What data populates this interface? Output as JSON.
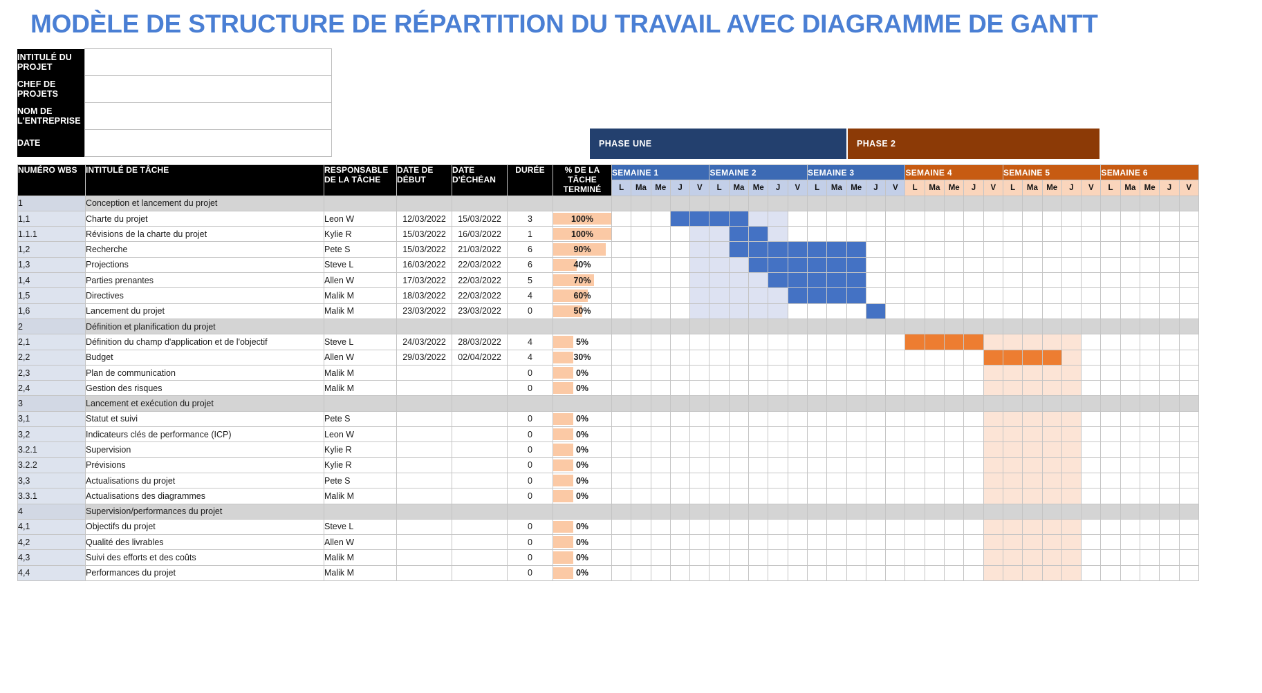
{
  "page_title": "MODÈLE DE STRUCTURE DE RÉPARTITION DU TRAVAIL AVEC DIAGRAMME DE GANTT",
  "info_block": [
    {
      "label": "INTITULÉ DU PROJET",
      "value": ""
    },
    {
      "label": "CHEF DE PROJETS",
      "value": ""
    },
    {
      "label": "NOM DE L'ENTREPRISE",
      "value": ""
    },
    {
      "label": "DATE",
      "value": ""
    }
  ],
  "phases": [
    {
      "label": "PHASE UNE",
      "color": "#23406e",
      "weeks": 3
    },
    {
      "label": "PHASE 2",
      "color": "#8c3a06",
      "weeks": 3
    }
  ],
  "columns": {
    "wbs": "NUMÉRO WBS",
    "task": "INTITULÉ DE TÂCHE",
    "resp": "RESPONSABLE DE LA TÂCHE",
    "start": "DATE DE DÉBUT",
    "end": "DATE D'ÉCHÉAN",
    "duration": "DURÉE",
    "percent": "% DE LA TÂCHE TERMINÉ"
  },
  "weeks": [
    {
      "label": "SEMAINE 1",
      "theme": "blue"
    },
    {
      "label": "SEMAINE 2",
      "theme": "blue"
    },
    {
      "label": "SEMAINE 3",
      "theme": "blue"
    },
    {
      "label": "SEMAINE 4",
      "theme": "orange"
    },
    {
      "label": "SEMAINE 5",
      "theme": "orange"
    },
    {
      "label": "SEMAINE 6",
      "theme": "orange"
    }
  ],
  "days": [
    "L",
    "Ma",
    "Me",
    "J",
    "V"
  ],
  "colors": {
    "title": "#4a7fd4",
    "phase_one": "#23406e",
    "phase_two": "#8c3a06",
    "week_blue": "#3c6ab4",
    "week_orange": "#c75b12",
    "day_blue": "#c3cfe8",
    "day_orange": "#fad5bc",
    "bar_blue": "#4472c4",
    "bar_orange": "#ed7d31",
    "shade_blue": "#dde2f2",
    "shade_orange": "#fce4d6",
    "pct_bar": "#fbc9a5",
    "wbs_bg": "#dde3ee",
    "section_bg": "#d4d4d4"
  },
  "rows": [
    {
      "type": "section",
      "wbs": "1",
      "task": "Conception et lancement du projet",
      "resp": "",
      "start": "",
      "end": "",
      "duration": "",
      "percent": "",
      "pct_value": 0,
      "bar": null,
      "shade": null
    },
    {
      "type": "task",
      "wbs": "1,1",
      "task": "Charte du projet",
      "resp": "Leon W",
      "start": "12/03/2022",
      "end": "15/03/2022",
      "duration": "3",
      "percent": "100%",
      "pct_value": 100,
      "bar": {
        "start": 4,
        "len": 4,
        "color": "blue"
      },
      "shade": {
        "start": 5,
        "len": 5,
        "color": "blue"
      }
    },
    {
      "type": "task",
      "wbs": "1.1.1",
      "task": "Révisions de la charte du projet",
      "resp": "Kylie R",
      "start": "15/03/2022",
      "end": "16/03/2022",
      "duration": "1",
      "percent": "100%",
      "pct_value": 100,
      "bar": {
        "start": 7,
        "len": 2,
        "color": "blue"
      },
      "shade": {
        "start": 5,
        "len": 5,
        "color": "blue"
      }
    },
    {
      "type": "task",
      "wbs": "1,2",
      "task": "Recherche",
      "resp": "Pete S",
      "start": "15/03/2022",
      "end": "21/03/2022",
      "duration": "6",
      "percent": "90%",
      "pct_value": 90,
      "bar": {
        "start": 7,
        "len": 7,
        "color": "blue"
      },
      "shade": {
        "start": 5,
        "len": 5,
        "color": "blue"
      }
    },
    {
      "type": "task",
      "wbs": "1,3",
      "task": "Projections",
      "resp": "Steve L",
      "start": "16/03/2022",
      "end": "22/03/2022",
      "duration": "6",
      "percent": "40%",
      "pct_value": 40,
      "bar": {
        "start": 8,
        "len": 6,
        "color": "blue"
      },
      "shade": {
        "start": 5,
        "len": 5,
        "color": "blue"
      }
    },
    {
      "type": "task",
      "wbs": "1,4",
      "task": "Parties prenantes",
      "resp": "Allen W",
      "start": "17/03/2022",
      "end": "22/03/2022",
      "duration": "5",
      "percent": "70%",
      "pct_value": 70,
      "bar": {
        "start": 9,
        "len": 5,
        "color": "blue"
      },
      "shade": {
        "start": 5,
        "len": 5,
        "color": "blue"
      }
    },
    {
      "type": "task",
      "wbs": "1,5",
      "task": "Directives",
      "resp": "Malik M",
      "start": "18/03/2022",
      "end": "22/03/2022",
      "duration": "4",
      "percent": "60%",
      "pct_value": 60,
      "bar": {
        "start": 10,
        "len": 4,
        "color": "blue"
      },
      "shade": {
        "start": 5,
        "len": 5,
        "color": "blue"
      }
    },
    {
      "type": "task",
      "wbs": "1,6",
      "task": "Lancement du projet",
      "resp": "Malik M",
      "start": "23/03/2022",
      "end": "23/03/2022",
      "duration": "0",
      "percent": "50%",
      "pct_value": 50,
      "bar": {
        "start": 14,
        "len": 1,
        "color": "blue"
      },
      "shade": {
        "start": 5,
        "len": 5,
        "color": "blue"
      }
    },
    {
      "type": "section",
      "wbs": "2",
      "task": "Définition et planification du projet",
      "resp": "",
      "start": "",
      "end": "",
      "duration": "",
      "percent": "",
      "pct_value": 0,
      "bar": null,
      "shade": null
    },
    {
      "type": "task",
      "wbs": "2,1",
      "task": "Définition du champ d'application et de l'objectif",
      "resp": "Steve L",
      "start": "24/03/2022",
      "end": "28/03/2022",
      "duration": "4",
      "percent": "5%",
      "pct_value": 5,
      "bar": {
        "start": 16,
        "len": 4,
        "color": "orange"
      },
      "shade": {
        "start": 20,
        "len": 5,
        "color": "orange"
      }
    },
    {
      "type": "task",
      "wbs": "2,2",
      "task": "Budget",
      "resp": "Allen W",
      "start": "29/03/2022",
      "end": "02/04/2022",
      "duration": "4",
      "percent": "30%",
      "pct_value": 30,
      "bar": {
        "start": 20,
        "len": 4,
        "color": "orange"
      },
      "shade": {
        "start": 20,
        "len": 5,
        "color": "orange"
      }
    },
    {
      "type": "task",
      "wbs": "2,3",
      "task": "Plan de communication",
      "resp": "Malik M",
      "start": "",
      "end": "",
      "duration": "0",
      "percent": "0%",
      "pct_value": 0,
      "bar": null,
      "shade": {
        "start": 20,
        "len": 5,
        "color": "orange"
      }
    },
    {
      "type": "task",
      "wbs": "2,4",
      "task": "Gestion des risques",
      "resp": "Malik M",
      "start": "",
      "end": "",
      "duration": "0",
      "percent": "0%",
      "pct_value": 0,
      "bar": null,
      "shade": {
        "start": 20,
        "len": 5,
        "color": "orange"
      }
    },
    {
      "type": "section",
      "wbs": "3",
      "task": "Lancement et exécution du projet",
      "resp": "",
      "start": "",
      "end": "",
      "duration": "",
      "percent": "",
      "pct_value": 0,
      "bar": null,
      "shade": null
    },
    {
      "type": "task",
      "wbs": "3,1",
      "task": "Statut et suivi",
      "resp": "Pete S",
      "start": "",
      "end": "",
      "duration": "0",
      "percent": "0%",
      "pct_value": 0,
      "bar": null,
      "shade": {
        "start": 20,
        "len": 5,
        "color": "orange"
      }
    },
    {
      "type": "task",
      "wbs": "3,2",
      "task": "Indicateurs clés de performance (ICP)",
      "resp": "Leon W",
      "start": "",
      "end": "",
      "duration": "0",
      "percent": "0%",
      "pct_value": 0,
      "bar": null,
      "shade": {
        "start": 20,
        "len": 5,
        "color": "orange"
      }
    },
    {
      "type": "task",
      "wbs": "3.2.1",
      "task": "Supervision",
      "resp": "Kylie R",
      "start": "",
      "end": "",
      "duration": "0",
      "percent": "0%",
      "pct_value": 0,
      "bar": null,
      "shade": {
        "start": 20,
        "len": 5,
        "color": "orange"
      }
    },
    {
      "type": "task",
      "wbs": "3.2.2",
      "task": "Prévisions",
      "resp": "Kylie R",
      "start": "",
      "end": "",
      "duration": "0",
      "percent": "0%",
      "pct_value": 0,
      "bar": null,
      "shade": {
        "start": 20,
        "len": 5,
        "color": "orange"
      }
    },
    {
      "type": "task",
      "wbs": "3,3",
      "task": "Actualisations du projet",
      "resp": "Pete S",
      "start": "",
      "end": "",
      "duration": "0",
      "percent": "0%",
      "pct_value": 0,
      "bar": null,
      "shade": {
        "start": 20,
        "len": 5,
        "color": "orange"
      }
    },
    {
      "type": "task",
      "wbs": "3.3.1",
      "task": "Actualisations des diagrammes",
      "resp": "Malik M",
      "start": "",
      "end": "",
      "duration": "0",
      "percent": "0%",
      "pct_value": 0,
      "bar": null,
      "shade": {
        "start": 20,
        "len": 5,
        "color": "orange"
      }
    },
    {
      "type": "section",
      "wbs": "4",
      "task": "Supervision/performances du projet",
      "resp": "",
      "start": "",
      "end": "",
      "duration": "",
      "percent": "",
      "pct_value": 0,
      "bar": null,
      "shade": null
    },
    {
      "type": "task",
      "wbs": "4,1",
      "task": "Objectifs du projet",
      "resp": "Steve L",
      "start": "",
      "end": "",
      "duration": "0",
      "percent": "0%",
      "pct_value": 0,
      "bar": null,
      "shade": {
        "start": 20,
        "len": 5,
        "color": "orange"
      }
    },
    {
      "type": "task",
      "wbs": "4,2",
      "task": "Qualité des livrables",
      "resp": "Allen W",
      "start": "",
      "end": "",
      "duration": "0",
      "percent": "0%",
      "pct_value": 0,
      "bar": null,
      "shade": {
        "start": 20,
        "len": 5,
        "color": "orange"
      }
    },
    {
      "type": "task",
      "wbs": "4,3",
      "task": "Suivi des efforts et des coûts",
      "resp": "Malik M",
      "start": "",
      "end": "",
      "duration": "0",
      "percent": "0%",
      "pct_value": 0,
      "bar": null,
      "shade": {
        "start": 20,
        "len": 5,
        "color": "orange"
      }
    },
    {
      "type": "task",
      "wbs": "4,4",
      "task": "Performances du projet",
      "resp": "Malik M",
      "start": "",
      "end": "",
      "duration": "0",
      "percent": "0%",
      "pct_value": 0,
      "bar": null,
      "shade": {
        "start": 20,
        "len": 5,
        "color": "orange"
      }
    }
  ]
}
